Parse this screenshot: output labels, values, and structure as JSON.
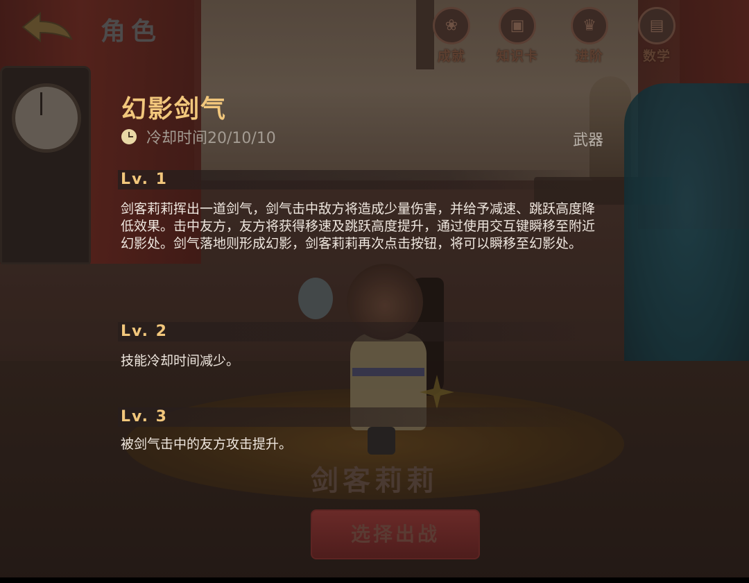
{
  "header": {
    "title": "角色",
    "buttons": [
      {
        "label": "成就",
        "icon": "achievement-icon"
      },
      {
        "label": "知识卡",
        "icon": "knowledge-card-icon"
      },
      {
        "label": "进阶",
        "icon": "advance-icon"
      },
      {
        "label": "数学",
        "icon": "stats-icon"
      }
    ]
  },
  "skill": {
    "name": "幻影剑气",
    "cooldown": "冷却时间20/10/10",
    "type": "武器",
    "levels": [
      {
        "label": "Lv. 1",
        "description": "剑客莉莉挥出一道剑气，剑气击中敌方将造成少量伤害，并给予减速、跳跃高度降低效果。击中友方，友方将获得移速及跳跃高度提升，通过使用交互键瞬移至附近幻影处。剑气落地则形成幻影，剑客莉莉再次点击按钮，将可以瞬移至幻影处。"
      },
      {
        "label": "Lv. 2",
        "description": "技能冷却时间减少。"
      },
      {
        "label": "Lv. 3",
        "description": "被剑气击中的友方攻击提升。"
      }
    ]
  },
  "character": {
    "name": "剑客莉莉",
    "select_label": "选择出战"
  },
  "colors": {
    "accent_gold": "#f2c77c",
    "text_white": "#efe7df",
    "muted_gray": "#a49c93"
  }
}
